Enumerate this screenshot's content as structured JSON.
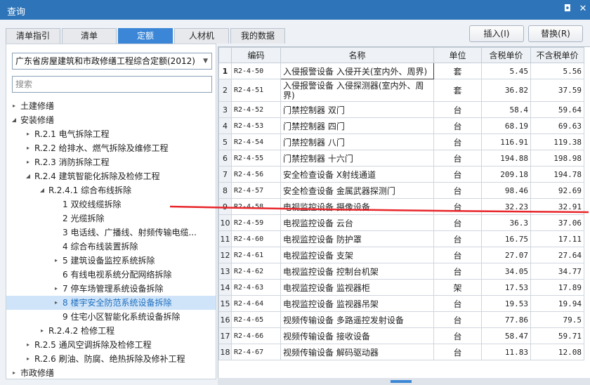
{
  "window": {
    "title": "查询",
    "restore_glyph": "◘",
    "close_glyph": "✕"
  },
  "tabs": [
    {
      "label": "清单指引",
      "active": false
    },
    {
      "label": "清单",
      "active": false
    },
    {
      "label": "定额",
      "active": true
    },
    {
      "label": "人材机",
      "active": false
    },
    {
      "label": "我的数据",
      "active": false
    }
  ],
  "toolbar": {
    "insert_label": "插入(I)",
    "replace_label": "替换(R)"
  },
  "left": {
    "quota_select": "广东省房屋建筑和市政修缮工程综合定额(2012)",
    "search_placeholder": "搜索",
    "tree": [
      {
        "label": "土建修缮",
        "level": 0,
        "arrow": "▸"
      },
      {
        "label": "安装修缮",
        "level": 0,
        "arrow": "◢"
      },
      {
        "label": "R.2.1 电气拆除工程",
        "level": 1,
        "arrow": "▸"
      },
      {
        "label": "R.2.2 给排水、燃气拆除及维修工程",
        "level": 1,
        "arrow": "▸"
      },
      {
        "label": "R.2.3 消防拆除工程",
        "level": 1,
        "arrow": "▸"
      },
      {
        "label": "R.2.4 建筑智能化拆除及检修工程",
        "level": 1,
        "arrow": "◢"
      },
      {
        "label": "R.2.4.1 综合布线拆除",
        "level": 2,
        "arrow": "◢"
      },
      {
        "label": "1 双绞线缆拆除",
        "level": 3,
        "arrow": ""
      },
      {
        "label": "2 光缆拆除",
        "level": 3,
        "arrow": ""
      },
      {
        "label": "3 电话线、广播线、射频传输电缆...",
        "level": 3,
        "arrow": ""
      },
      {
        "label": "4 综合布线装置拆除",
        "level": 3,
        "arrow": ""
      },
      {
        "label": "5 建筑设备监控系统拆除",
        "level": 3,
        "arrow": "▸"
      },
      {
        "label": "6 有线电视系统分配网络拆除",
        "level": 3,
        "arrow": ""
      },
      {
        "label": "7 停车场管理系统设备拆除",
        "level": 3,
        "arrow": "▸"
      },
      {
        "label": "8 楼宇安全防范系统设备拆除",
        "level": 3,
        "arrow": "▸",
        "selected": true
      },
      {
        "label": "9 住宅小区智能化系统设备拆除",
        "level": 3,
        "arrow": ""
      },
      {
        "label": "R.2.4.2 检修工程",
        "level": 2,
        "arrow": "▸"
      },
      {
        "label": "R.2.5 通风空调拆除及检修工程",
        "level": 1,
        "arrow": "▸"
      },
      {
        "label": "R.2.6 刷油、防腐、绝热拆除及修补工程",
        "level": 1,
        "arrow": "▸"
      },
      {
        "label": "市政修缮",
        "level": 0,
        "arrow": "▸"
      }
    ]
  },
  "table": {
    "headers": [
      "",
      "编码",
      "名称",
      "单位",
      "含税单价",
      "不含税单价"
    ],
    "rows": [
      {
        "idx": "1",
        "code": "R2-4-50",
        "name": "入侵报警设备 入侵开关(室内外、周界)",
        "unit": "套",
        "price_tax": "5.45",
        "price_notax": "5.56",
        "current": true
      },
      {
        "idx": "2",
        "code": "R2-4-51",
        "name": "入侵报警设备 入侵探测器(室内外、周界)",
        "unit": "套",
        "price_tax": "36.82",
        "price_notax": "37.59",
        "tall": true
      },
      {
        "idx": "3",
        "code": "R2-4-52",
        "name": "门禁控制器 双门",
        "unit": "台",
        "price_tax": "58.4",
        "price_notax": "59.64"
      },
      {
        "idx": "4",
        "code": "R2-4-53",
        "name": "门禁控制器 四门",
        "unit": "台",
        "price_tax": "68.19",
        "price_notax": "69.63"
      },
      {
        "idx": "5",
        "code": "R2-4-54",
        "name": "门禁控制器 八门",
        "unit": "台",
        "price_tax": "116.91",
        "price_notax": "119.38"
      },
      {
        "idx": "6",
        "code": "R2-4-55",
        "name": "门禁控制器 十六门",
        "unit": "台",
        "price_tax": "194.88",
        "price_notax": "198.98"
      },
      {
        "idx": "7",
        "code": "R2-4-56",
        "name": "安全检查设备 X射线通道",
        "unit": "台",
        "price_tax": "209.18",
        "price_notax": "194.78"
      },
      {
        "idx": "8",
        "code": "R2-4-57",
        "name": "安全检查设备 金属武器探测门",
        "unit": "台",
        "price_tax": "98.46",
        "price_notax": "92.69"
      },
      {
        "idx": "9",
        "code": "R2-4-58",
        "name": "电视监控设备 摄像设备",
        "unit": "台",
        "price_tax": "32.23",
        "price_notax": "32.91"
      },
      {
        "idx": "10",
        "code": "R2-4-59",
        "name": "电视监控设备 云台",
        "unit": "台",
        "price_tax": "36.3",
        "price_notax": "37.06"
      },
      {
        "idx": "11",
        "code": "R2-4-60",
        "name": "电视监控设备 防护罩",
        "unit": "台",
        "price_tax": "16.75",
        "price_notax": "17.11"
      },
      {
        "idx": "12",
        "code": "R2-4-61",
        "name": "电视监控设备 支架",
        "unit": "台",
        "price_tax": "27.07",
        "price_notax": "27.64"
      },
      {
        "idx": "13",
        "code": "R2-4-62",
        "name": "电视监控设备 控制台机架",
        "unit": "台",
        "price_tax": "34.05",
        "price_notax": "34.77"
      },
      {
        "idx": "14",
        "code": "R2-4-63",
        "name": "电视监控设备 监视器柜",
        "unit": "架",
        "price_tax": "17.53",
        "price_notax": "17.89"
      },
      {
        "idx": "15",
        "code": "R2-4-64",
        "name": "电视监控设备 监视器吊架",
        "unit": "台",
        "price_tax": "19.53",
        "price_notax": "19.94"
      },
      {
        "idx": "16",
        "code": "R2-4-65",
        "name": "视频传输设备 多路遥控发射设备",
        "unit": "台",
        "price_tax": "77.86",
        "price_notax": "79.5"
      },
      {
        "idx": "17",
        "code": "R2-4-66",
        "name": "视频传输设备 接收设备",
        "unit": "台",
        "price_tax": "58.47",
        "price_notax": "59.71"
      },
      {
        "idx": "18",
        "code": "R2-4-67",
        "name": "视频传输设备 解码驱动器",
        "unit": "台",
        "price_tax": "11.83",
        "price_notax": "12.08"
      }
    ]
  },
  "colors": {
    "accent": "#3b86d6",
    "titlebar": "#2d74b8",
    "annotation": "#e8262b"
  }
}
